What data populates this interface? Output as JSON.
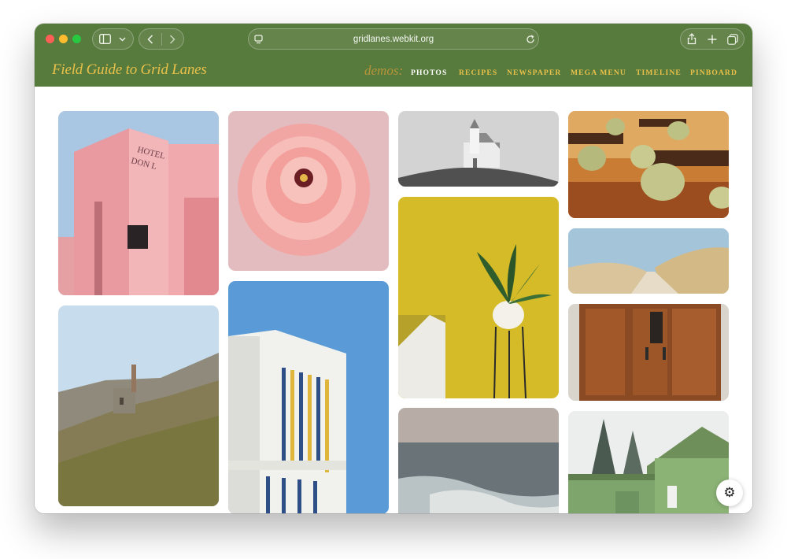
{
  "browser": {
    "url": "gridlanes.webkit.org",
    "icons": [
      "sidebar-icon",
      "chevron-down-icon",
      "back-icon",
      "forward-icon",
      "page-icon",
      "reload-icon",
      "share-icon",
      "new-tab-icon",
      "tabs-overview-icon"
    ]
  },
  "site": {
    "title": "Field Guide to Grid Lanes",
    "demos_label": "demos:",
    "nav": [
      {
        "label": "PHOTOS",
        "active": true
      },
      {
        "label": "RECIPES",
        "active": false
      },
      {
        "label": "NEWSPAPER",
        "active": false
      },
      {
        "label": "MEGA MENU",
        "active": false
      },
      {
        "label": "TIMELINE",
        "active": false
      },
      {
        "label": "PINBOARD",
        "active": false
      }
    ],
    "accent_color": "#e9c14a",
    "header_color": "#577a3d"
  },
  "photos": [
    {
      "subject": "pink hotel building"
    },
    {
      "subject": "pink ranunculus flower"
    },
    {
      "subject": "white chapel on a hill"
    },
    {
      "subject": "cafe tables and green chairs"
    },
    {
      "subject": "sand dunes path"
    },
    {
      "subject": "wooden door"
    },
    {
      "subject": "mine engine house on hillside"
    },
    {
      "subject": "white and blue building against sky"
    },
    {
      "subject": "potted plant against yellow wall"
    },
    {
      "subject": "ocean waves"
    },
    {
      "subject": "green wooden house in snow"
    }
  ],
  "settings_icon": "gear-icon"
}
